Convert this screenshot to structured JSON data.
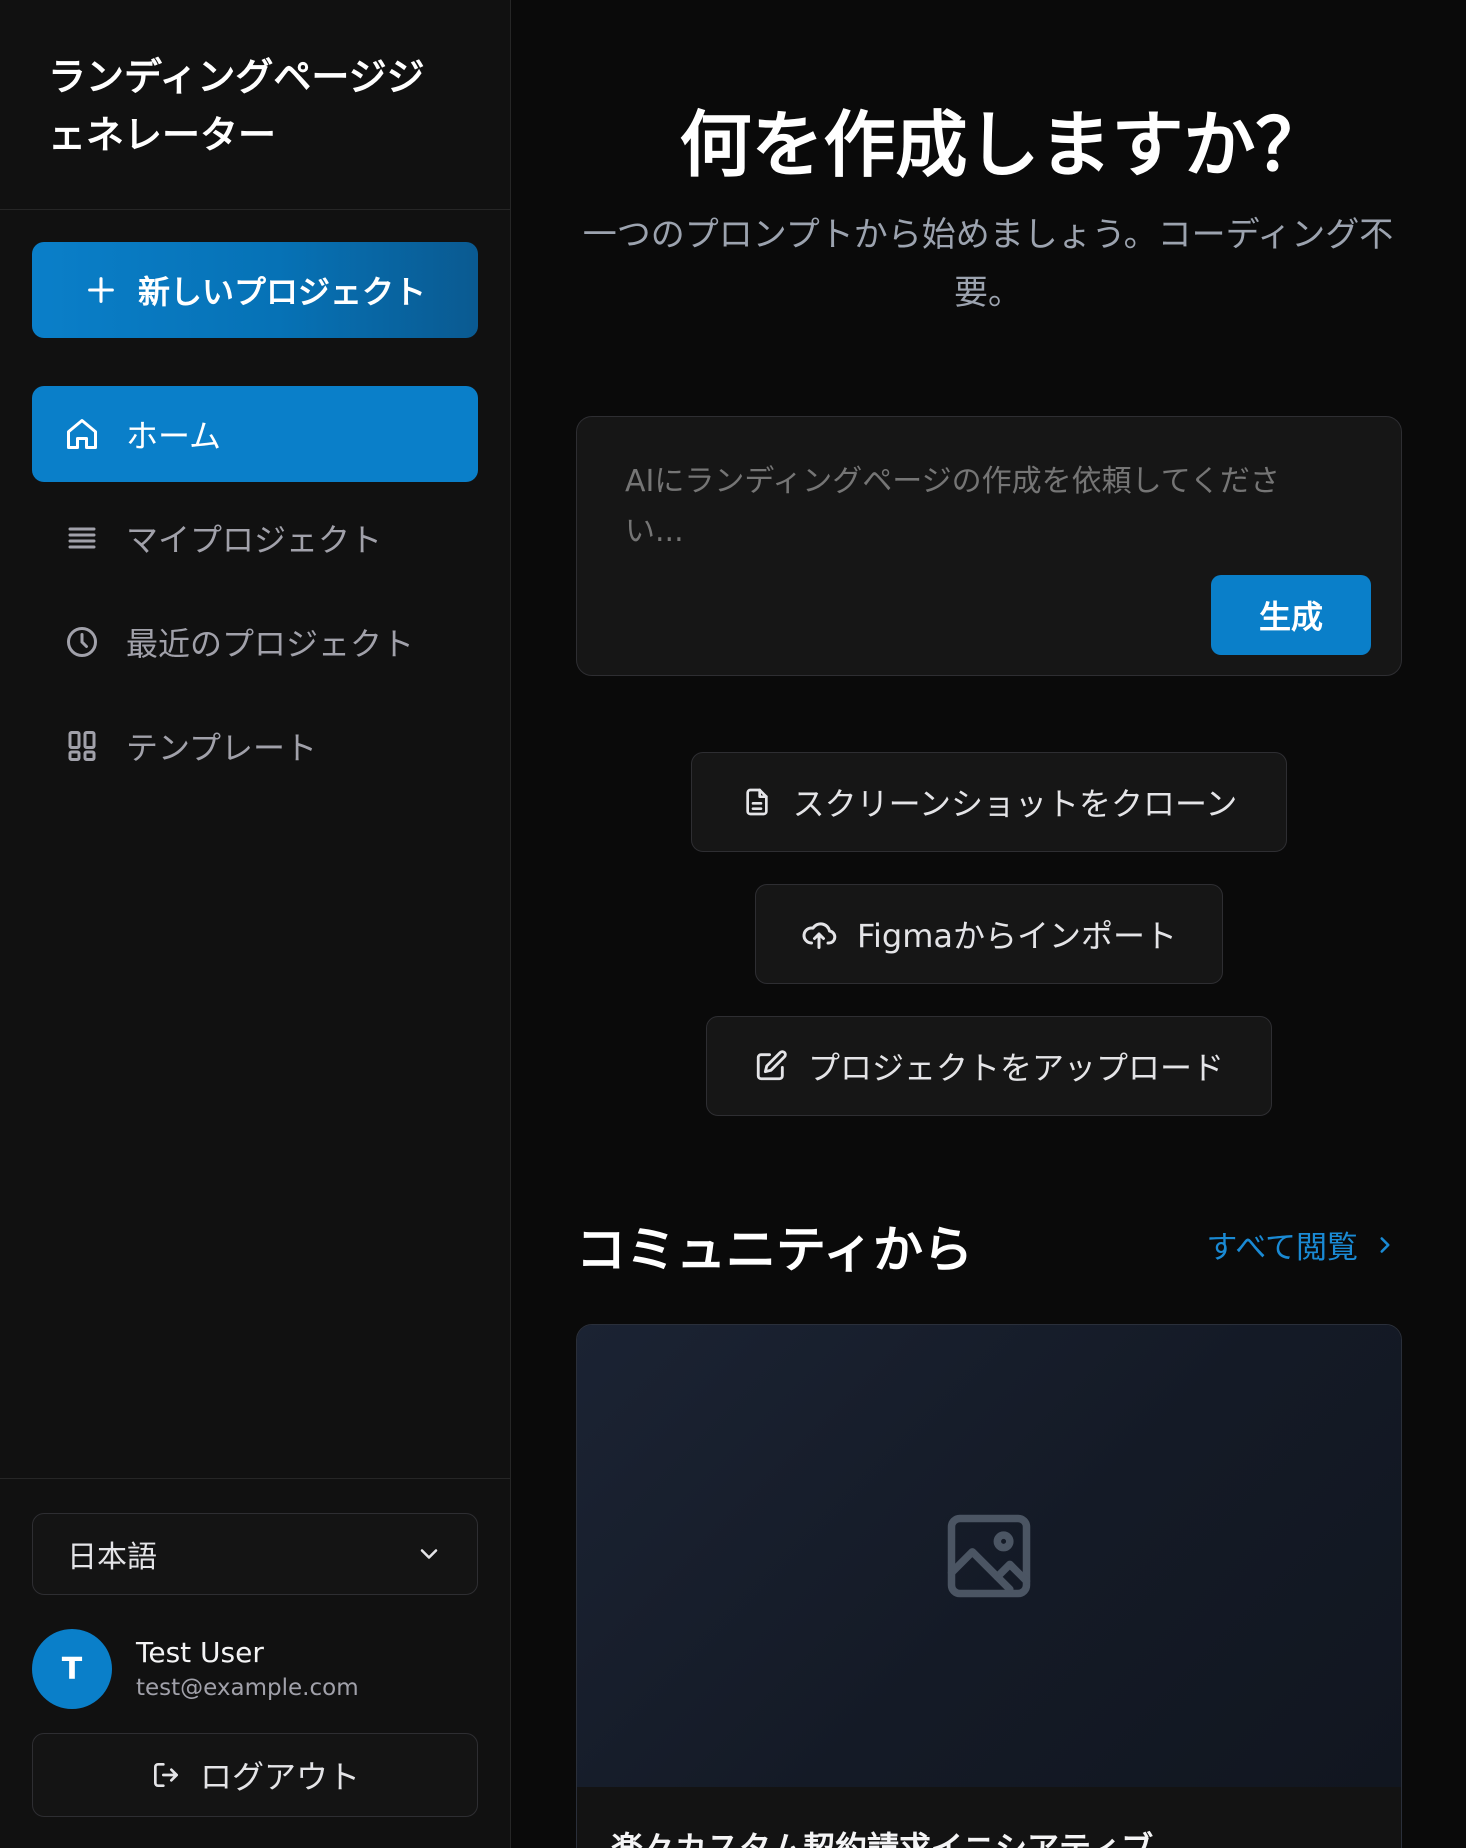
{
  "sidebar": {
    "app_title_line1": "ランディングページジ",
    "app_title_line2": "ェネレーター",
    "new_project_label": "新しいプロジェクト",
    "nav": [
      {
        "label": "ホーム",
        "icon": "home-icon",
        "active": true
      },
      {
        "label": "マイプロジェクト",
        "icon": "list-icon",
        "active": false
      },
      {
        "label": "最近のプロジェクト",
        "icon": "clock-icon",
        "active": false
      },
      {
        "label": "テンプレート",
        "icon": "grid-icon",
        "active": false
      }
    ],
    "language": "日本語",
    "user": {
      "initial": "T",
      "name": "Test User",
      "email": "test@example.com"
    },
    "logout_label": "ログアウト"
  },
  "main": {
    "headline": "何を作成しますか？",
    "subline": "一つのプロンプトから始めましょう。コーディング不要。",
    "prompt_placeholder": "AIにランディングページの作成を依頼してください...",
    "generate_label": "生成",
    "actions": [
      {
        "label": "スクリーンショットをクローン",
        "icon": "document-icon"
      },
      {
        "label": "Figmaからインポート",
        "icon": "cloud-upload-icon"
      },
      {
        "label": "プロジェクトをアップロード",
        "icon": "edit-icon"
      }
    ],
    "community_title": "コミュニティから",
    "see_all_label": "すべて閲覧",
    "card_title": "楽々カスタム契約請求イニシアティブ"
  },
  "colors": {
    "accent": "#0a7fc9",
    "background": "#0a0a0a",
    "sidebar": "#111111",
    "link": "#1a8ad4"
  }
}
